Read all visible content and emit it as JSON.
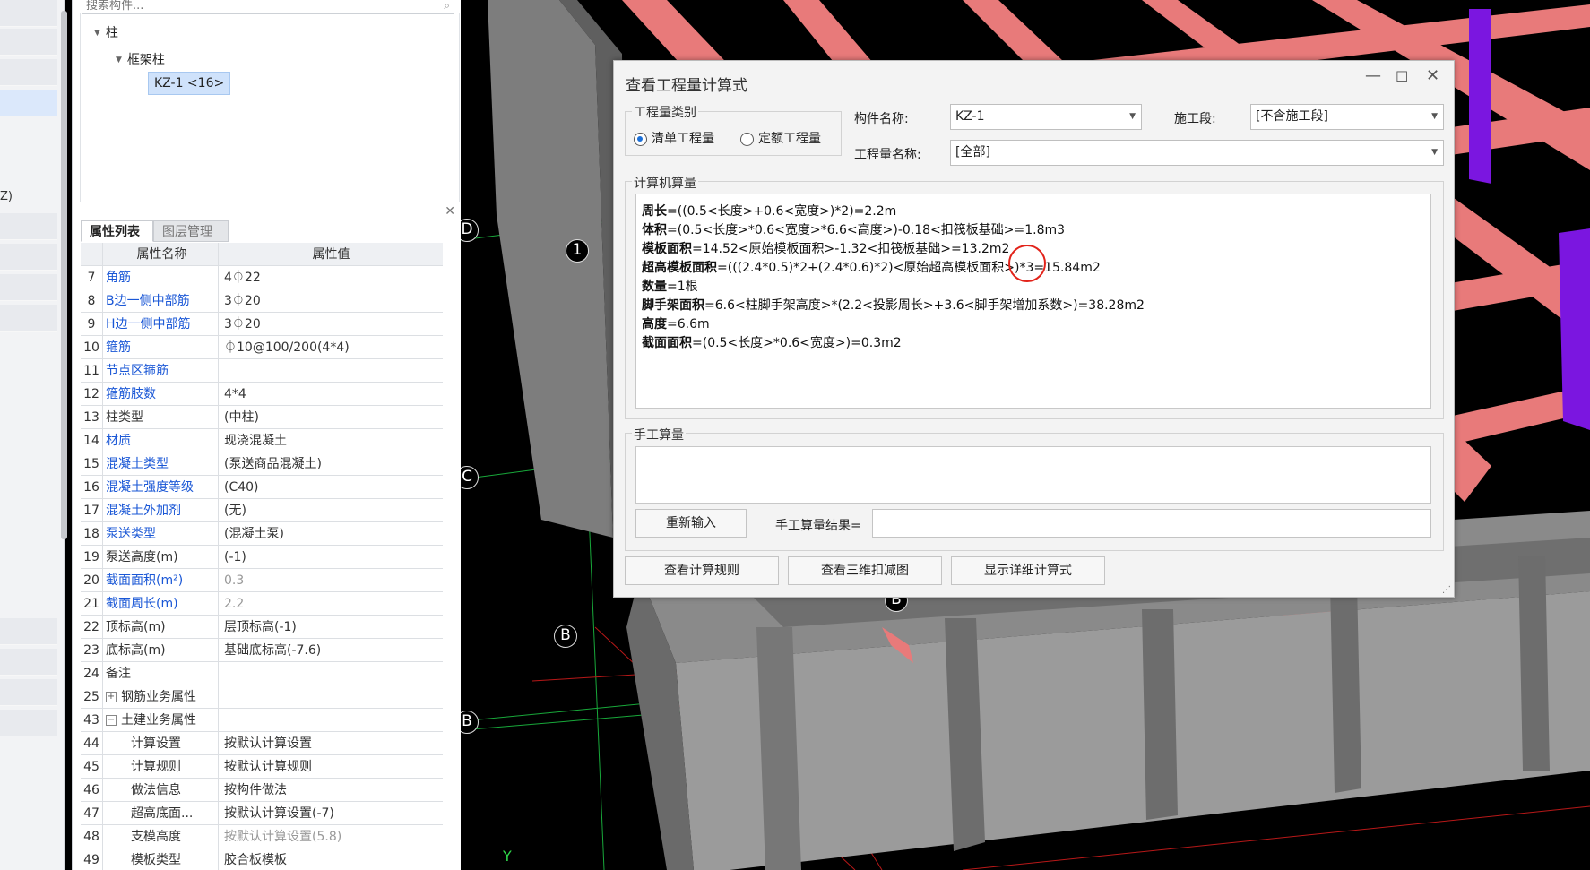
{
  "left_strip": {
    "partial_text": "Z)"
  },
  "tree": {
    "search_placeholder": "搜索构件...",
    "nodes": [
      {
        "label": "柱"
      },
      {
        "label": "框架柱"
      },
      {
        "label": "KZ-1 <16>"
      }
    ]
  },
  "props": {
    "tabs": [
      "属性列表",
      "图层管理"
    ],
    "header": {
      "name": "属性名称",
      "value": "属性值"
    },
    "rows": [
      {
        "num": "7",
        "name": "角筋",
        "value": "4⏀22"
      },
      {
        "num": "8",
        "name": "B边一侧中部筋",
        "value": "3⏀20"
      },
      {
        "num": "9",
        "name": "H边一侧中部筋",
        "value": "3⏀20"
      },
      {
        "num": "10",
        "name": "箍筋",
        "value": "⏀10@100/200(4*4)"
      },
      {
        "num": "11",
        "name": "节点区箍筋",
        "value": ""
      },
      {
        "num": "12",
        "name": "箍筋肢数",
        "value": "4*4"
      },
      {
        "num": "13",
        "name": "柱类型",
        "value": "(中柱)"
      },
      {
        "num": "14",
        "name": "材质",
        "value": "现浇混凝土"
      },
      {
        "num": "15",
        "name": "混凝土类型",
        "value": "(泵送商品混凝土)"
      },
      {
        "num": "16",
        "name": "混凝土强度等级",
        "value": "(C40)"
      },
      {
        "num": "17",
        "name": "混凝土外加剂",
        "value": "(无)"
      },
      {
        "num": "18",
        "name": "泵送类型",
        "value": "(混凝土泵)"
      },
      {
        "num": "19",
        "name": "泵送高度(m)",
        "value": "(-1)"
      },
      {
        "num": "20",
        "name": "截面面积(m²)",
        "value": "0.3"
      },
      {
        "num": "21",
        "name": "截面周长(m)",
        "value": "2.2"
      },
      {
        "num": "22",
        "name": "顶标高(m)",
        "value": "层顶标高(-1)"
      },
      {
        "num": "23",
        "name": "底标高(m)",
        "value": "基础底标高(-7.6)"
      },
      {
        "num": "24",
        "name": "备注",
        "value": ""
      },
      {
        "num": "25",
        "name": "钢筋业务属性",
        "value": "",
        "expander": "+"
      },
      {
        "num": "43",
        "name": "土建业务属性",
        "value": "",
        "expander": "−"
      },
      {
        "num": "44",
        "name": "计算设置",
        "value": "按默认计算设置"
      },
      {
        "num": "45",
        "name": "计算规则",
        "value": "按默认计算规则"
      },
      {
        "num": "46",
        "name": "做法信息",
        "value": "按构件做法"
      },
      {
        "num": "47",
        "name": "超高底面...",
        "value": "按默认计算设置(-7)"
      },
      {
        "num": "48",
        "name": "支模高度",
        "value": "按默认计算设置(5.8)"
      },
      {
        "num": "49",
        "name": "模板类型",
        "value": "胶合板模板"
      }
    ]
  },
  "viewport": {
    "axis_labels": [
      "D",
      "1",
      "C",
      "B",
      "B",
      "B"
    ],
    "coord_y": "Y",
    "colors": {
      "beam": "#e87a7a",
      "wall": "#8a8a8a",
      "column": "#7b16e0",
      "grid_red": "#b81818",
      "grid_green": "#18a83a"
    }
  },
  "dialog": {
    "title": "查看工程量计算式",
    "win_minimize": "—",
    "win_maximize": "☐",
    "win_close": "✕",
    "qty_type": {
      "legend": "工程量类别",
      "opt1": "清单工程量",
      "opt2": "定额工程量",
      "selected": "清单工程量"
    },
    "component_label": "构件名称:",
    "component_value": "KZ-1",
    "stage_label": "施工段:",
    "stage_value": "[不含施工段]",
    "qty_name_label": "工程量名称:",
    "qty_name_value": "[全部]",
    "computer_section": "计算机算量",
    "calc_lines": [
      {
        "key": "周长",
        "expr": "=((0.5<长度>+0.6<宽度>)*2)=2.2m"
      },
      {
        "key": "体积",
        "expr": "=(0.5<长度>*0.6<宽度>*6.6<高度>)-0.18<扣筏板基础>=1.8m3"
      },
      {
        "key": "模板面积",
        "expr": "=14.52<原始模板面积>-1.32<扣筏板基础>=13.2m2"
      },
      {
        "key": "超高模板面积",
        "expr": "=(((2.4*0.5)*2+(2.4*0.6)*2)<原始超高模板面积>)*3=15.84m2"
      },
      {
        "key": "数量",
        "expr": "=1根"
      },
      {
        "key": "脚手架面积",
        "expr": "=6.6<柱脚手架高度>*(2.2<投影周长>+3.6<脚手架增加系数>)=38.28m2"
      },
      {
        "key": "高度",
        "expr": "=6.6m"
      },
      {
        "key": "截面面积",
        "expr": "=(0.5<长度>*0.6<宽度>)=0.3m2"
      }
    ],
    "manual_section": "手工算量",
    "reenter_button": "重新输入",
    "manual_result_label": "手工算量结果=",
    "manual_result_value": "",
    "btn_rules": "查看计算规则",
    "btn_3d": "查看三维扣减图",
    "btn_detail": "显示详细计算式"
  }
}
